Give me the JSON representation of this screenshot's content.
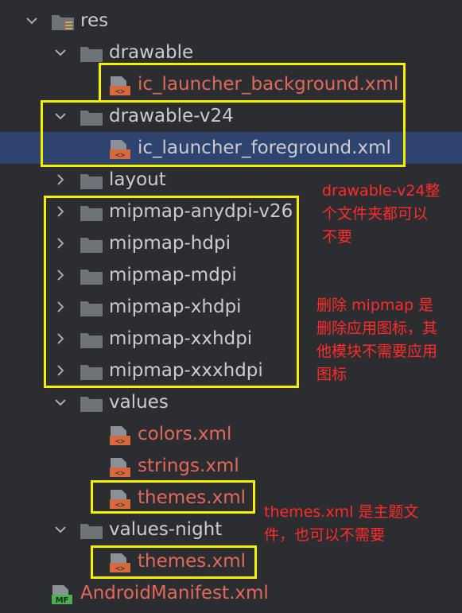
{
  "tree": {
    "res": "res",
    "drawable": "drawable",
    "drawable_file": "ic_launcher_background.xml",
    "drawable_v24": "drawable-v24",
    "drawable_v24_file": "ic_launcher_foreground.xml",
    "layout": "layout",
    "mipmap": [
      "mipmap-anydpi-v26",
      "mipmap-hdpi",
      "mipmap-mdpi",
      "mipmap-xhdpi",
      "mipmap-xxhdpi",
      "mipmap-xxxhdpi"
    ],
    "values": "values",
    "values_files": [
      "colors.xml",
      "strings.xml",
      "themes.xml"
    ],
    "values_night": "values-night",
    "values_night_file": "themes.xml",
    "manifest": "AndroidManifest.xml",
    "manifest_badge": "MF",
    "xml_badge": "<>"
  },
  "annotations": {
    "drawable_v24": [
      "drawable-v24整",
      "个文件夹都可以",
      "不要"
    ],
    "mipmap": [
      "删除 mipmap 是",
      "删除应用图标，其",
      "他模块不需要应用",
      "图标"
    ],
    "themes": [
      "themes.xml 是主题文",
      "件，也可以不需要"
    ]
  },
  "colors": {
    "background": "#2b2d30",
    "selection": "#2e436e",
    "folder_text": "#c9ccd2",
    "file_text": "#e3685c",
    "highlight": "#f6f000",
    "annotation": "#ff2b2b"
  }
}
